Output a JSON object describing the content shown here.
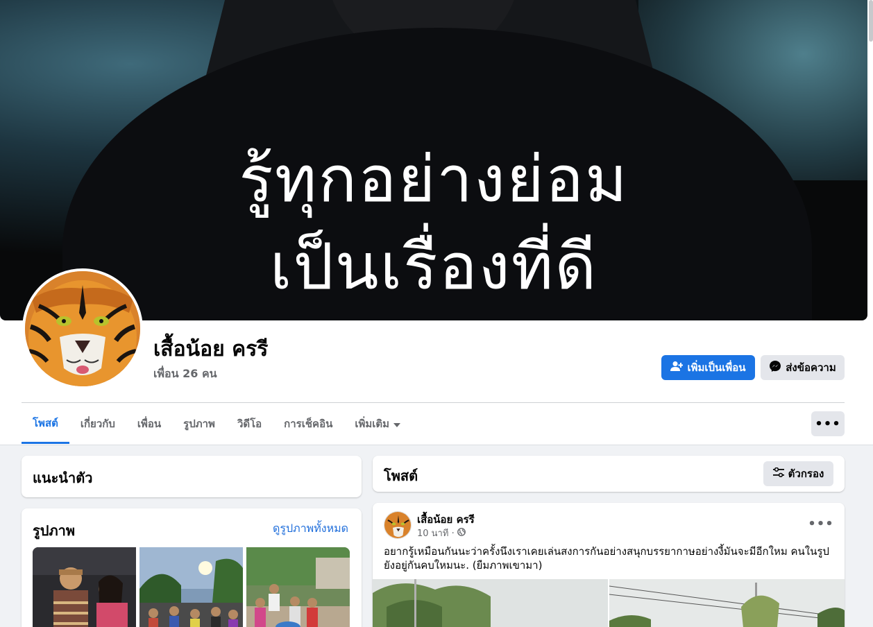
{
  "cover": {
    "line1": "รู้ทุกอย่างย่อม",
    "line2": "เป็นเรื่องที่ดี"
  },
  "profile": {
    "name": "เสื้อน้อย ครรี",
    "friends": "เพื่อน 26 คน"
  },
  "actions": {
    "add_friend": "เพิ่มเป็นเพื่อน",
    "message": "ส่งข้อความ"
  },
  "tabs": [
    {
      "label": "โพสต์",
      "active": true
    },
    {
      "label": "เกี่ยวกับ"
    },
    {
      "label": "เพื่อน"
    },
    {
      "label": "รูปภาพ"
    },
    {
      "label": "วิดีโอ"
    },
    {
      "label": "การเช็คอิน"
    },
    {
      "label": "เพิ่มเติม"
    }
  ],
  "more_dots": "•••",
  "intro": {
    "title": "แนะนำตัว"
  },
  "photos": {
    "title": "รูปภาพ",
    "see_all": "ดูรูปภาพทั้งหมด"
  },
  "posts": {
    "title": "โพสต์",
    "filter": "ตัวกรอง"
  },
  "post": {
    "author": "เสื้อน้อย ครรี",
    "time": "10 นาที ·",
    "text": "อยากรู้เหมือนกันนะว่าครั้งนึงเราเคยเล่นสงการกันอย่างสนุกบรรยากาษอย่างงี้มันจะมีอีกใหม คนในรูปยังอยู่กันคบใหมนะ. (ยืมภาพเขามา)",
    "more": "•••"
  },
  "colors": {
    "accent": "#1b74e4",
    "link": "#216fdb",
    "muted_text": "#65676b",
    "background": "#f0f2f5",
    "button_gray": "#e4e6eb"
  },
  "icons": {
    "add_friend": "add-friend-icon",
    "message": "messenger-icon",
    "dropdown": "chevron-down-icon",
    "filter": "filter-sliders-icon",
    "privacy": "globe-icon"
  }
}
